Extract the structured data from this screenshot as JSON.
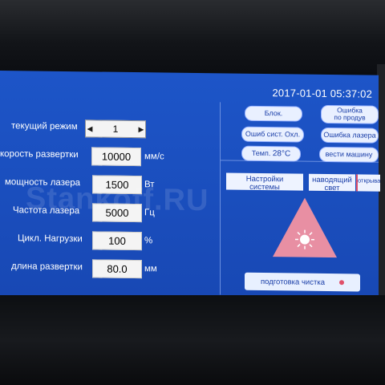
{
  "header": {
    "datetime": "2017-01-01 05:37:02"
  },
  "params": [
    {
      "label": "текущий режим",
      "value": "1",
      "unit": ""
    },
    {
      "label": "корость развертки",
      "value": "10000",
      "unit": "мм/с"
    },
    {
      "label": "мощность лазера",
      "value": "1500",
      "unit": "Вт"
    },
    {
      "label": "Частота лазера",
      "value": "5000",
      "unit": "Гц"
    },
    {
      "label": "Цикл. Нагрузки",
      "value": "100",
      "unit": "%"
    },
    {
      "label": "длина развертки",
      "value": "80.0",
      "unit": "мм"
    }
  ],
  "status": {
    "block": "Блок.",
    "product_error_line1": "Ошибка",
    "product_error_line2": "по продув",
    "cooling_error": "Ошиб сист. Охл.",
    "laser_error": "Ошибка лазера",
    "temp_label": "Темп.",
    "temp_value": "28",
    "temp_unit": "°C",
    "machine": "вести машину"
  },
  "panel": {
    "settings_line1": "Настройки",
    "settings_line2": "системы",
    "guide_line1": "наводящий",
    "guide_line2": "свет",
    "open": "открывать",
    "prep_clean": "подготовка чистка"
  },
  "watermark": "Stankoff.RU",
  "colors": {
    "screen_blue": "#1d55c8",
    "warning_triangle": "#e88fa3",
    "status_dot": "#e0506a"
  }
}
